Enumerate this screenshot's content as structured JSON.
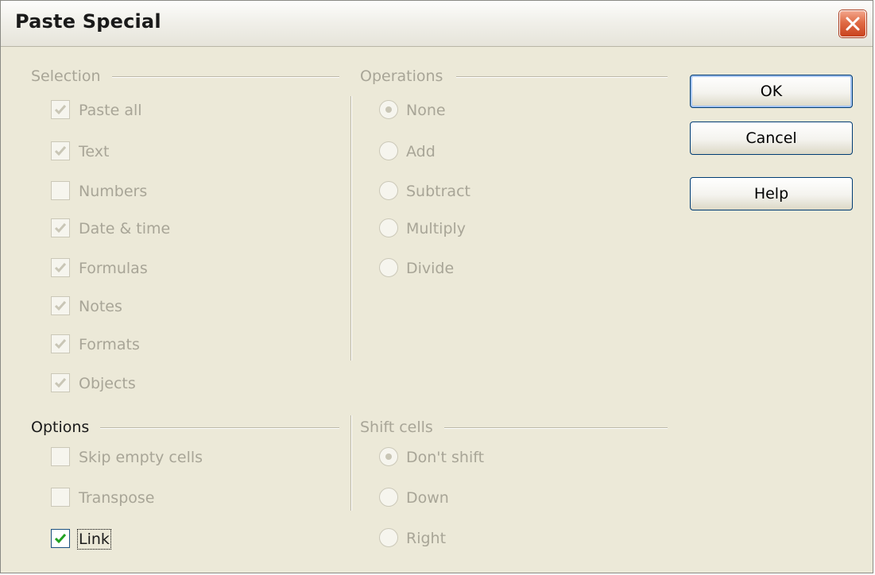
{
  "window": {
    "title": "Paste Special"
  },
  "selection": {
    "heading": "Selection",
    "items": [
      {
        "label": "Paste all",
        "checked": true
      },
      {
        "label": "Text",
        "checked": true
      },
      {
        "label": "Numbers",
        "checked": false
      },
      {
        "label": "Date & time",
        "checked": true
      },
      {
        "label": "Formulas",
        "checked": true
      },
      {
        "label": "Notes",
        "checked": true
      },
      {
        "label": "Formats",
        "checked": true
      },
      {
        "label": "Objects",
        "checked": true
      }
    ]
  },
  "operations": {
    "heading": "Operations",
    "items": [
      {
        "label": "None",
        "selected": true
      },
      {
        "label": "Add",
        "selected": false
      },
      {
        "label": "Subtract",
        "selected": false
      },
      {
        "label": "Multiply",
        "selected": false
      },
      {
        "label": "Divide",
        "selected": false
      }
    ]
  },
  "options": {
    "heading": "Options",
    "items": [
      {
        "label": "Skip empty cells",
        "checked": false
      },
      {
        "label": "Transpose",
        "checked": false
      },
      {
        "label": "Link",
        "checked": true
      }
    ]
  },
  "shift_cells": {
    "heading": "Shift cells",
    "items": [
      {
        "label": "Don't shift",
        "selected": true
      },
      {
        "label": "Down",
        "selected": false
      },
      {
        "label": "Right",
        "selected": false
      }
    ]
  },
  "buttons": {
    "ok": "OK",
    "cancel": "Cancel",
    "help": "Help"
  },
  "colors": {
    "disabled_text": "#a8a597",
    "dialog_bg": "#ece9d8",
    "button_border": "#003c74",
    "close_red": "#d9542e"
  }
}
